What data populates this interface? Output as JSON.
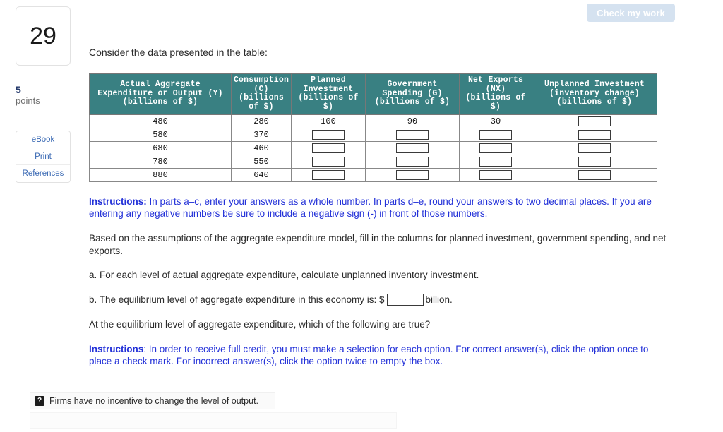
{
  "toolbar": {
    "check_my_work_label": "Check my work"
  },
  "sidebar": {
    "question_number": "29",
    "points_value": "5",
    "points_label": "points",
    "buttons": [
      {
        "label": "eBook"
      },
      {
        "label": "Print"
      },
      {
        "label": "References"
      }
    ]
  },
  "main": {
    "lead_line": "Consider the data presented in the table:",
    "table": {
      "headers": [
        "Actual Aggregate Expenditure or Output (Y) (billions of $)",
        "Consumption (C) (billions of $)",
        "Planned Investment (billions of $)",
        "Government Spending (G) (billions of $)",
        "Net Exports (NX) (billions of $)",
        "Unplanned Investment (inventory change) (billions of $)"
      ],
      "headers_lines": {
        "y": [
          "Actual Aggregate",
          "Expenditure or Output (Y)",
          "(billions of $)"
        ],
        "c": [
          "Consumption",
          "(C)",
          "(billions",
          "of $)"
        ],
        "i": [
          "Planned",
          "Investment",
          "(billions of",
          "$)"
        ],
        "g": [
          "Government",
          "Spending (G)",
          "(billions of $)"
        ],
        "nx": [
          "Net Exports",
          "(NX)",
          "(billions of",
          "$)"
        ],
        "un": [
          "Unplanned Investment",
          "(inventory change)",
          "(billions of $)"
        ]
      },
      "rows": [
        {
          "y": "480",
          "c": "280",
          "i": "100",
          "g": "90",
          "nx": "30",
          "un": ""
        },
        {
          "y": "580",
          "c": "370",
          "i": "",
          "g": "",
          "nx": "",
          "un": ""
        },
        {
          "y": "680",
          "c": "460",
          "i": "",
          "g": "",
          "nx": "",
          "un": ""
        },
        {
          "y": "780",
          "c": "550",
          "i": "",
          "g": "",
          "nx": "",
          "un": ""
        },
        {
          "y": "880",
          "c": "640",
          "i": "",
          "g": "",
          "nx": "",
          "un": ""
        }
      ]
    },
    "instructions_1_bold": "Instructions:",
    "instructions_1_text": " In parts a–c, enter your answers as a whole number. In parts d–e, round your answers to two decimal places. If you are entering any negative numbers be sure to include a negative sign (-) in front of those numbers.",
    "paragraph_based": "Based on the assumptions of the aggregate expenditure model, fill in the columns for planned investment, government spending, and net exports.",
    "part_a": "a. For each level of actual aggregate expenditure, calculate unplanned inventory investment.",
    "part_b_prefix": "b. The equilibrium level of aggregate expenditure in this economy is: $",
    "part_b_suffix": "billion.",
    "part_b_value": "",
    "equilibrium_question": "At the equilibrium level of aggregate expenditure, which of the following are true?",
    "instructions_2_bold": "Instructions",
    "instructions_2_text": ": In order to receive full credit, you must make a selection for each option. For correct answer(s), click the option once to place a check mark. For incorrect answer(s), click the option twice to empty the box.",
    "options": [
      {
        "marker": "?",
        "text": "Firms have no incentive to change the level of output."
      }
    ]
  },
  "colors": {
    "table_header_teal": "#398082",
    "instruction_blue": "#2331d8",
    "link_blue": "#3b6ab4",
    "check_button_bg": "#d5e2f0",
    "points_navy": "#24396b"
  }
}
